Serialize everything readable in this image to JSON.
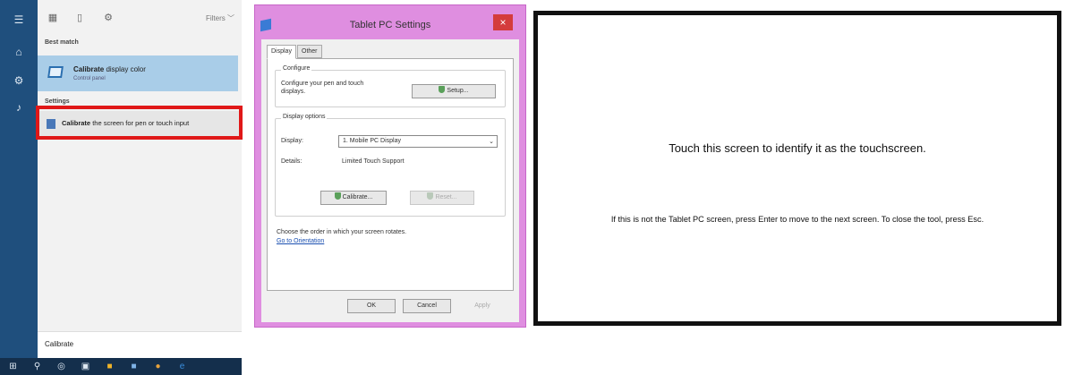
{
  "start_menu": {
    "filters_label": "Filters",
    "best_match_label": "Best match",
    "best_match": {
      "title_bold": "Calibrate",
      "title_rest": " display color",
      "subtitle": "Control panel"
    },
    "settings_label": "Settings",
    "settings_item": {
      "bold": "Calibrate",
      "rest": " the screen for pen or touch input"
    },
    "search_query": "Calibrate",
    "highlight_color": "#e01818"
  },
  "tablet_window": {
    "title": "Tablet PC Settings",
    "close_glyph": "×",
    "tabs": [
      "Display",
      "Other"
    ],
    "configure_group": "Configure",
    "configure_text": "Configure your pen and touch displays.",
    "setup_button": "Setup...",
    "display_options_group": "Display options",
    "display_label": "Display:",
    "display_value": "1. Mobile PC Display",
    "details_label": "Details:",
    "details_value": "Limited Touch Support",
    "calibrate_button": "Calibrate...",
    "reset_button": "Reset...",
    "rotate_text": "Choose the order in which your screen rotates.",
    "orientation_link": "Go to Orientation",
    "ok_button": "OK",
    "cancel_button": "Cancel",
    "apply_button": "Apply",
    "frame_color": "#df8ee0"
  },
  "touch_screen": {
    "headline": "Touch this screen to identify it as the touchscreen.",
    "instructions": "If this is not the Tablet PC screen, press Enter to move to the next screen. To close the tool, press Esc."
  },
  "icons": [
    "hamburger-icon",
    "home-icon",
    "gear-icon",
    "person-icon",
    "document-icon",
    "windows-icon",
    "search-icon",
    "task-view-icon",
    "store-icon",
    "explorer-icon",
    "mail-icon",
    "chrome-icon",
    "edge-icon"
  ]
}
